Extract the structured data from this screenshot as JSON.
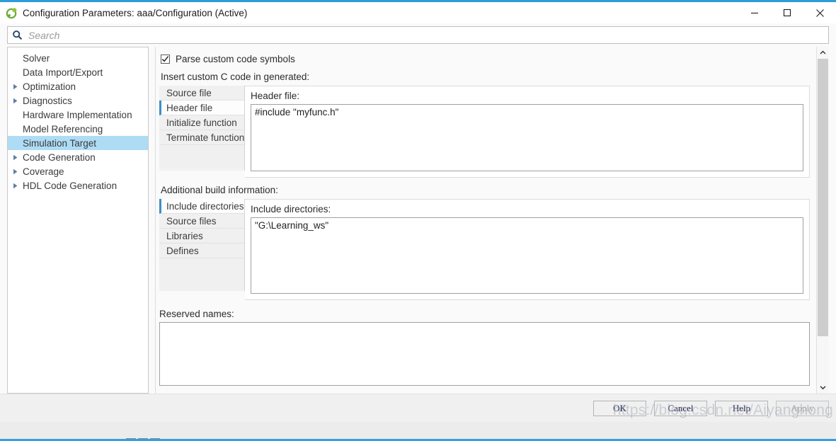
{
  "window": {
    "title": "Configuration Parameters: aaa/Configuration (Active)",
    "icon": "simulink-icon",
    "accent_color": "#2d9cdb",
    "controls": {
      "minimize": "minimize-icon",
      "maximize": "maximize-icon",
      "close": "close-icon"
    }
  },
  "search": {
    "icon": "search-icon",
    "placeholder": "Search",
    "value": ""
  },
  "tree": {
    "selected": "Simulation Target",
    "items": [
      {
        "label": "Solver",
        "expandable": false
      },
      {
        "label": "Data Import/Export",
        "expandable": false
      },
      {
        "label": "Optimization",
        "expandable": true
      },
      {
        "label": "Diagnostics",
        "expandable": true
      },
      {
        "label": "Hardware Implementation",
        "expandable": false
      },
      {
        "label": "Model Referencing",
        "expandable": false
      },
      {
        "label": "Simulation Target",
        "expandable": false
      },
      {
        "label": "Code Generation",
        "expandable": true
      },
      {
        "label": "Coverage",
        "expandable": true
      },
      {
        "label": "HDL Code Generation",
        "expandable": true
      }
    ]
  },
  "main": {
    "parse_checkbox": {
      "label": "Parse custom code symbols",
      "checked": true
    },
    "custom_code": {
      "section_label": "Insert custom C code in generated:",
      "tabs": [
        {
          "label": "Source file",
          "selected": false
        },
        {
          "label": "Header file",
          "selected": true
        },
        {
          "label": "Initialize function",
          "selected": false
        },
        {
          "label": "Terminate function",
          "selected": false
        }
      ],
      "field_label": "Header file:",
      "value": "#include \"myfunc.h\""
    },
    "build_info": {
      "section_label": "Additional build information:",
      "tabs": [
        {
          "label": "Include directories",
          "selected": true
        },
        {
          "label": "Source files",
          "selected": false
        },
        {
          "label": "Libraries",
          "selected": false
        },
        {
          "label": "Defines",
          "selected": false
        }
      ],
      "field_label": "Include directories:",
      "value": "\"G:\\Learning_ws\""
    },
    "reserved_names": {
      "label": "Reserved names:",
      "value": ""
    },
    "overflow_ellipsis": "..."
  },
  "footer": {
    "buttons": [
      {
        "label": "OK",
        "disabled": false
      },
      {
        "label": "Cancel",
        "disabled": false
      },
      {
        "label": "Help",
        "disabled": false
      },
      {
        "label": "Apply",
        "disabled": true
      }
    ]
  },
  "watermark": {
    "text": "https://blog.csdn.net/Aiyanghong"
  }
}
